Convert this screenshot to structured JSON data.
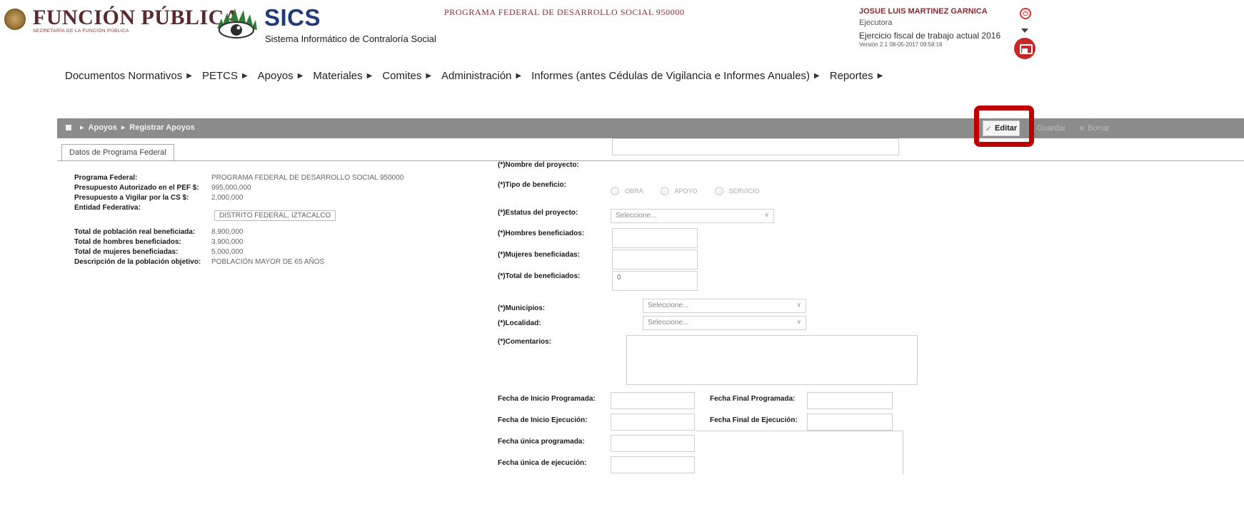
{
  "header": {
    "brand_title": "FUNCIÓN PÚBLICA",
    "brand_sub": "SECRETARÍA DE LA FUNCIÓN PÚBLICA",
    "app_title": "SICS",
    "app_sub": "Sistema Informático de Contraloría Social",
    "program_title": "PROGRAMA FEDERAL DE DESARROLLO SOCIAL 950000",
    "user_name": "JOSUE LUIS MARTINEZ GARNICA",
    "user_role": "Ejecutora",
    "fiscal_year": "Ejercicio fiscal de trabajo actual 2016",
    "version": "Versión 2.1  08-05-2017 09:58:16"
  },
  "menu": [
    {
      "label": "Documentos Normativos"
    },
    {
      "label": "PETCS"
    },
    {
      "label": "Apoyos"
    },
    {
      "label": "Materiales"
    },
    {
      "label": "Comites"
    },
    {
      "label": "Administración"
    },
    {
      "label": "Informes (antes Cédulas de Vigilancia e Informes Anuales)"
    },
    {
      "label": "Reportes"
    }
  ],
  "toolbar": {
    "crumb_1": "Apoyos",
    "crumb_2": "Registrar Apoyos",
    "edit_label": "Editar",
    "save_label": "Guardar",
    "close_label": "Borrar"
  },
  "tabs": {
    "active": "Datos de Programa Federal"
  },
  "program_info": [
    {
      "label": "Programa Federal:",
      "value": "PROGRAMA FEDERAL DE DESARROLLO SOCIAL 950000"
    },
    {
      "label": "Presupuesto Autorizado en el PEF $:",
      "value": "995,000,000"
    },
    {
      "label": "Presupuesto a Vigilar por la CS $:",
      "value": "2,000,000"
    },
    {
      "label": "Entidad Federativa:",
      "value": "DISTRITO FEDERAL, IZTACALCO"
    },
    {
      "label": "Total de población real beneficiada:",
      "value": "8,900,000"
    },
    {
      "label": "Total de hombres beneficiados:",
      "value": "3,900,000"
    },
    {
      "label": "Total de mujeres beneficiadas:",
      "value": "5,000,000"
    },
    {
      "label": "Descripción de la población objetivo:",
      "value": "POBLACIÓN MAYOR DE 65 AÑOS"
    }
  ],
  "form": {
    "nombre_label": "(*)Nombre del proyecto:",
    "nombre_value": "",
    "tipo_label": "(*)Tipo de beneficio:",
    "tipo_options": [
      "OBRA",
      "APOYO",
      "SERVICIO"
    ],
    "estatus_label": "(*)Estatus del proyecto:",
    "estatus_value": "Seleccione...",
    "hombres_label": "(*)Hombres beneficiados:",
    "hombres_value": "",
    "mujeres_label": "(*)Mujeres beneficiadas:",
    "mujeres_value": "",
    "total_label": "(*)Total de beneficiados:",
    "total_value": "0",
    "municipios_label": "(*)Municipios:",
    "municipios_value": "Seleccione...",
    "localidad_label": "(*)Localidad:",
    "localidad_value": "Seleccione...",
    "comentarios_label": "(*)Comentarios:",
    "fecha_inicio_prog_label": "Fecha de Inicio Programada:",
    "fecha_final_prog_label": "Fecha Final Programada:",
    "fecha_inicio_ejec_label": "Fecha de Inicio Ejecución:",
    "fecha_final_ejec_label": "Fecha Final de Ejecución:",
    "fecha_unica_prog_label": "Fecha única programada:",
    "fecha_unica_ejec_label": "Fecha única de ejecución:"
  }
}
